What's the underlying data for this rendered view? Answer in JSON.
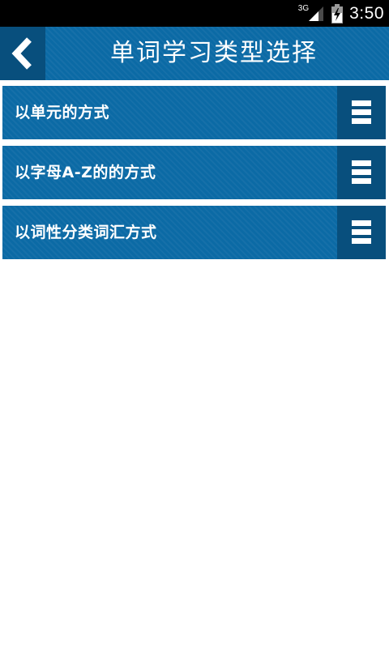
{
  "status_bar": {
    "network": "3G",
    "time": "3:50",
    "icons": [
      "signal-icon",
      "battery-icon"
    ]
  },
  "header": {
    "title": "单词学习类型选择",
    "back_icon": "chevron-left-icon"
  },
  "options": [
    {
      "label": "以单元的方式",
      "icon": "menu-icon"
    },
    {
      "label": "以字母A-Z的的方式",
      "icon": "menu-icon"
    },
    {
      "label": "以词性分类词汇方式",
      "icon": "menu-icon"
    }
  ],
  "colors": {
    "accent": "#0b6aa5",
    "accent_dark": "#084f7d",
    "text": "#ffffff",
    "status_bar": "#000000"
  }
}
